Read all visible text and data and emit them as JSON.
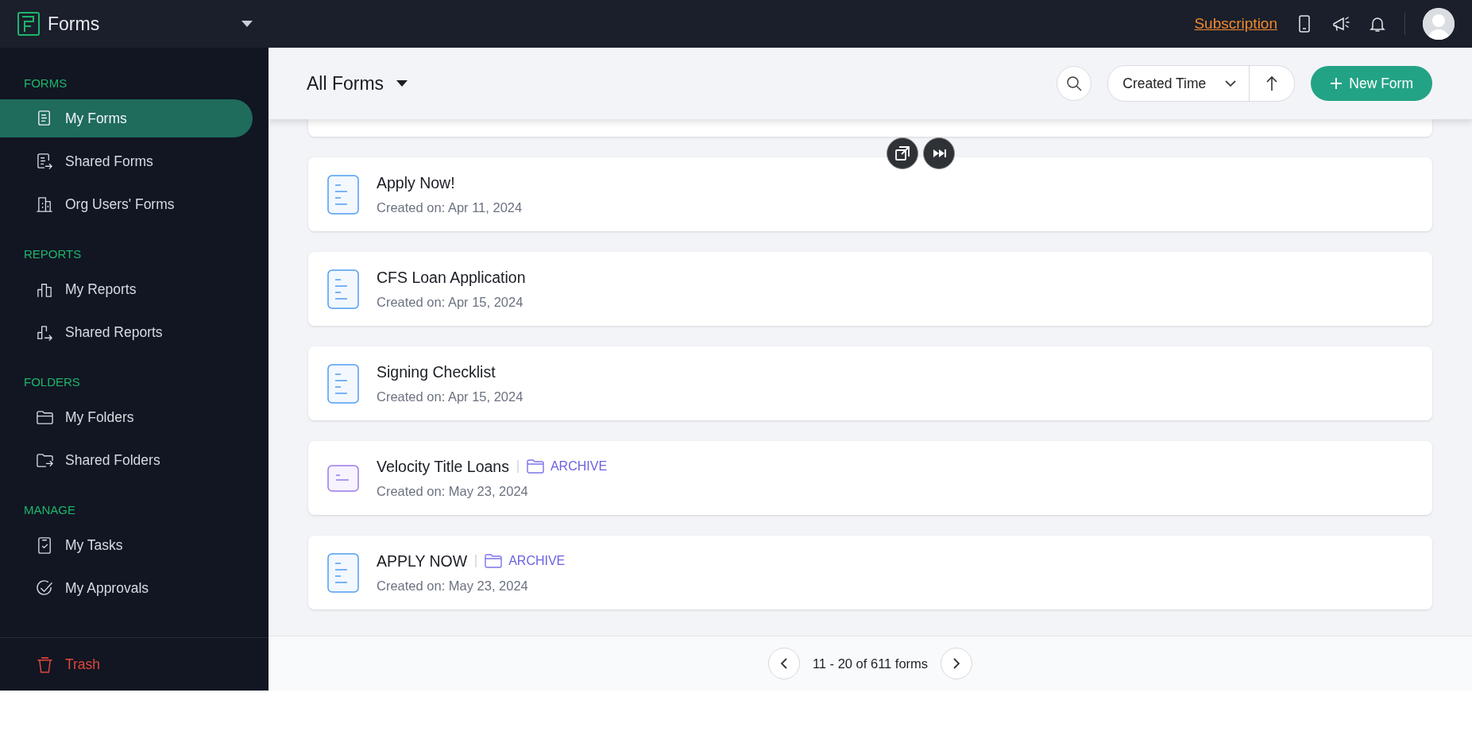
{
  "app": {
    "title": "Forms"
  },
  "top_bar": {
    "link": "Subscription"
  },
  "sidebar": {
    "sections": [
      {
        "title": "FORMS",
        "items": [
          {
            "label": "My Forms",
            "selected": true
          },
          {
            "label": "Shared Forms",
            "selected": false
          },
          {
            "label": "Org Users' Forms",
            "selected": false
          }
        ]
      },
      {
        "title": "REPORTS",
        "items": [
          {
            "label": "My Reports",
            "selected": false
          },
          {
            "label": "Shared Reports",
            "selected": false
          }
        ]
      },
      {
        "title": "FOLDERS",
        "items": [
          {
            "label": "My Folders",
            "selected": false
          },
          {
            "label": "Shared Folders",
            "selected": false
          }
        ]
      },
      {
        "title": "MANAGE",
        "items": [
          {
            "label": "My Tasks",
            "selected": false
          },
          {
            "label": "My Approvals",
            "selected": false
          }
        ]
      }
    ],
    "trash": "Trash"
  },
  "header": {
    "title": "All Forms",
    "sort": "Created Time",
    "new_button": "New Form"
  },
  "forms": [
    {
      "name": "Apply Now!",
      "created": "Created on: Apr 11, 2024",
      "kind": "portrait"
    },
    {
      "name": "CFS Loan Application",
      "created": "Created on: Apr 15, 2024",
      "kind": "portrait"
    },
    {
      "name": "Signing Checklist",
      "created": "Created on: Apr 15, 2024",
      "kind": "portrait"
    },
    {
      "name": "Velocity Title Loans",
      "created": "Created on: May 23, 2024",
      "kind": "landscape",
      "folder": "ARCHIVE"
    },
    {
      "name": "APPLY NOW",
      "created": "Created on: May 23, 2024",
      "kind": "portrait",
      "folder": "ARCHIVE"
    }
  ],
  "pagination": {
    "text": "11 - 20 of 611 forms"
  }
}
